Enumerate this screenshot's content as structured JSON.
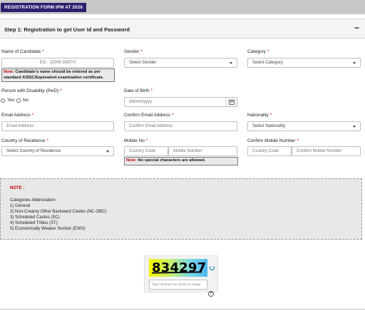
{
  "header": {
    "title": "REGISTRATION FORM IPM AT 2026"
  },
  "step": {
    "title": "Step 1: Registration to get User Id and Password",
    "collapse_symbol": "−"
  },
  "fields": {
    "name": {
      "label": "Name of Candidate",
      "placeholder": "EG -  JOHN SMITH",
      "note_prefix": "Note:",
      "note_text": " Candidate's name should be entered as per standard X/SSC/Equivalent examination certificate."
    },
    "gender": {
      "label": "Gender",
      "value": "Select Gender"
    },
    "category": {
      "label": "Category",
      "value": "Select Category"
    },
    "pwd": {
      "label": "Person with Disability (PwD)",
      "options": [
        "Yes",
        "No"
      ]
    },
    "dob": {
      "label": "Date of Birth",
      "placeholder": "dd/mm/yyyy"
    },
    "email": {
      "label": "Email Address",
      "placeholder": "Email Address"
    },
    "confirm_email": {
      "label": "Confirm Email Address",
      "placeholder": "Confirm Email Address"
    },
    "nationality": {
      "label": "Nationality",
      "value": "Select Nationality"
    },
    "country": {
      "label": "Country of Residence",
      "value": "Select Country of Residence"
    },
    "mobile": {
      "label": "Mobile No",
      "code_placeholder": "Country Code",
      "number_placeholder": "Mobile Number",
      "note_prefix": "Note:",
      "note_text": " No special characters are allowed."
    },
    "confirm_mobile": {
      "label": "Confirm Mobile Number",
      "code_placeholder": "Country Code",
      "number_placeholder": "Confirm Mobile Number"
    },
    "required_mark": "*"
  },
  "notice": {
    "title": "NOTE :",
    "heading": "Categories Abbreviation :",
    "items": [
      "1) General",
      "2) Non-Creamy Other Backward Castes (NC-OBC)",
      "3) Scheduled Castes (SC)",
      "4) Scheduled Tribes (ST)",
      "5) Economically Weaker Section (EWS)"
    ]
  },
  "captcha": {
    "code": "834297",
    "placeholder": "Type numbers as shown in image",
    "help": "?"
  },
  "colors": {
    "header_badge": "#2d1f6e",
    "required": "#d40000",
    "note": "#c00000"
  },
  "icons": {
    "calendar": "calendar-icon",
    "refresh": "refresh-icon",
    "help": "help-icon"
  }
}
